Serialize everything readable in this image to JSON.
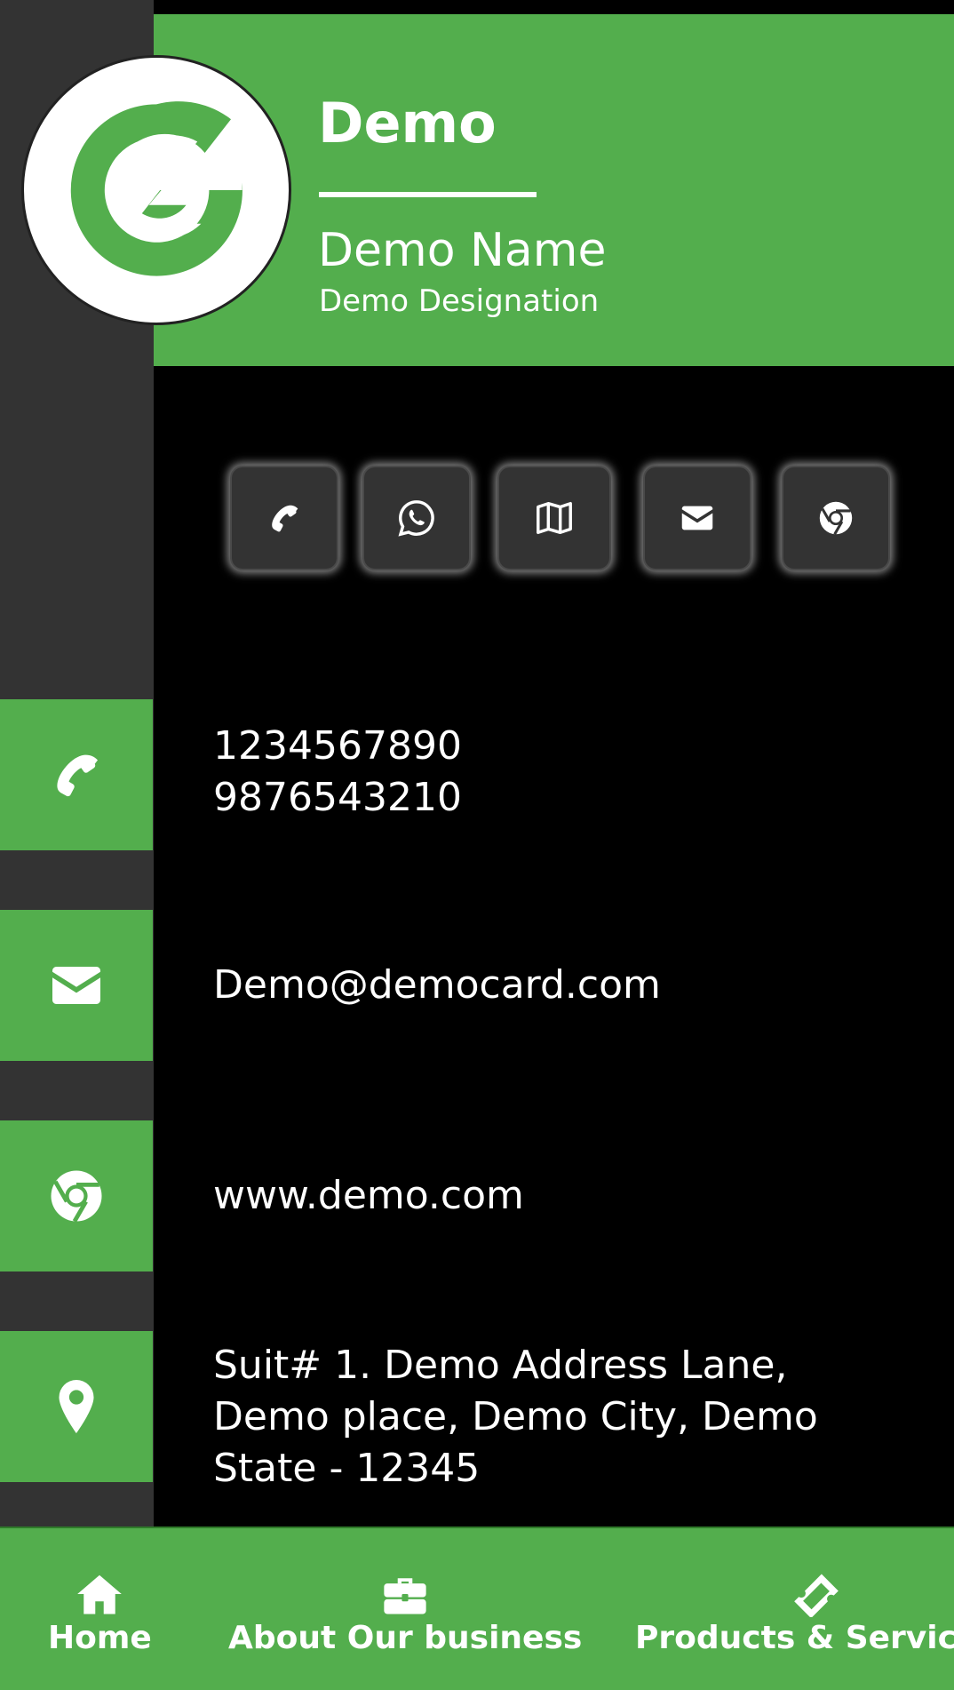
{
  "header": {
    "company": "Demo",
    "person_name": "Demo Name",
    "designation": "Demo Designation"
  },
  "colors": {
    "accent": "#53AE4D",
    "sidebar": "#333333",
    "background": "#000000"
  },
  "quick_actions": [
    {
      "icon": "phone-icon"
    },
    {
      "icon": "whatsapp-icon"
    },
    {
      "icon": "map-icon"
    },
    {
      "icon": "email-icon"
    },
    {
      "icon": "chrome-icon"
    }
  ],
  "contact": {
    "phones": [
      "1234567890",
      "9876543210"
    ],
    "email": "Demo@democard.com",
    "website": "www.demo.com",
    "address_lines": [
      "Suit# 1. Demo Address Lane,",
      "Demo place, Demo City, Demo",
      "State - 12345"
    ]
  },
  "bottom_nav": [
    {
      "label": "Home",
      "icon": "home-icon"
    },
    {
      "label": "About Our business",
      "icon": "briefcase-icon"
    },
    {
      "label": "Products & Services",
      "icon": "ticket-icon"
    }
  ]
}
